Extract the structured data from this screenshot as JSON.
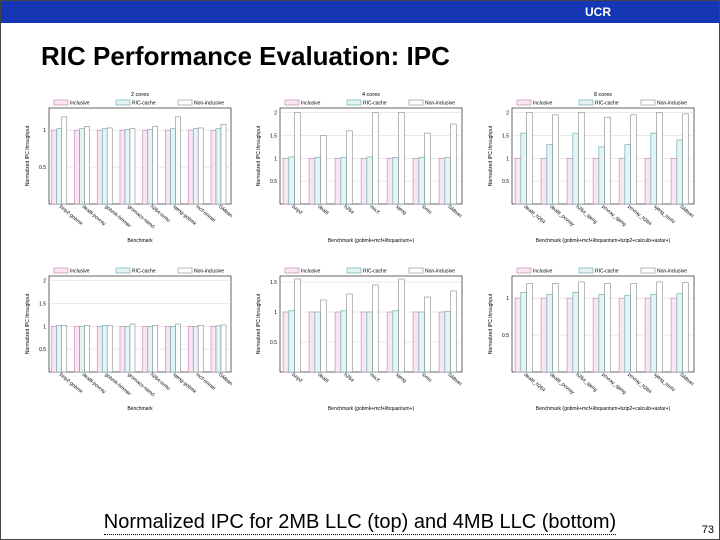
{
  "banner": "UCR",
  "title": "RIC Performance Evaluation: IPC",
  "caption": "Normalized IPC for 2MB LLC (top) and 4MB LLC (bottom)",
  "page_num": "73",
  "legend": [
    "Inclusive",
    "RIC-cache",
    "Non-inclusive"
  ],
  "ylabel": "Normalized IPC throughput",
  "xlabel": "Benchmark",
  "chart_data": [
    {
      "id": "p0",
      "title": "2 cores",
      "type": "bar",
      "ylim": [
        0,
        1.3
      ],
      "yticks": [
        0.5,
        1
      ],
      "xlabel_note": "Benchmark",
      "categories": [
        "bzip2-gobmk",
        "dealII-povray",
        "gobmk-hmmer",
        "gromacs-namd",
        "h264-tonto",
        "sjeng-gobmk",
        "mcf-omnet",
        "GMean"
      ],
      "series": [
        {
          "name": "Inclusive",
          "values": [
            1,
            1,
            1,
            1,
            1,
            1,
            1,
            1
          ]
        },
        {
          "name": "RIC-cache",
          "values": [
            1.02,
            1.02,
            1.02,
            1.01,
            1.01,
            1.02,
            1.02,
            1.02
          ]
        },
        {
          "name": "Non-inclusive",
          "values": [
            1.18,
            1.05,
            1.03,
            1.02,
            1.05,
            1.18,
            1.03,
            1.08
          ]
        }
      ]
    },
    {
      "id": "p1",
      "title": "4 cores",
      "type": "bar",
      "ylim": [
        0,
        2.1
      ],
      "yticks": [
        0.5,
        1,
        1.5,
        2
      ],
      "xlabel_note": "Benchmark (gobmk+mcf+libquantum+)",
      "categories": [
        "bzip2",
        "dealII",
        "h264",
        "mixX",
        "sjeng",
        "tonto",
        "GMean"
      ],
      "series": [
        {
          "name": "Inclusive",
          "values": [
            1,
            1,
            1,
            1,
            1,
            1,
            1
          ]
        },
        {
          "name": "RIC-cache",
          "values": [
            1.03,
            1.02,
            1.02,
            1.03,
            1.02,
            1.02,
            1.02
          ]
        },
        {
          "name": "Non-inclusive",
          "values": [
            2.0,
            1.5,
            1.6,
            2.0,
            2.0,
            1.55,
            1.75
          ]
        }
      ]
    },
    {
      "id": "p2",
      "title": "8 cores",
      "type": "bar",
      "ylim": [
        0,
        2.1
      ],
      "yticks": [
        0.5,
        1,
        1.5,
        2
      ],
      "xlabel_note": "Benchmark (gobmk+mcf+libquantum+bzip2+calculix+astar+)",
      "categories": [
        "dealII_h264",
        "dealII_povray",
        "h264_sjeng",
        "povray_sjeng",
        "povray_h264",
        "sjeng_tonto",
        "GMean"
      ],
      "series": [
        {
          "name": "Inclusive",
          "values": [
            1,
            1,
            1,
            1,
            1,
            1,
            1
          ]
        },
        {
          "name": "RIC-cache",
          "values": [
            1.55,
            1.3,
            1.55,
            1.25,
            1.3,
            1.55,
            1.4
          ]
        },
        {
          "name": "Non-inclusive",
          "values": [
            2.0,
            1.95,
            2.0,
            1.9,
            1.95,
            2.0,
            1.97
          ]
        }
      ]
    },
    {
      "id": "p3",
      "title": "",
      "type": "bar",
      "ylim": [
        0,
        2.1
      ],
      "yticks": [
        0.5,
        1,
        1.5,
        2
      ],
      "xlabel_note": "Benchmark",
      "categories": [
        "bzip2-gobmk",
        "dealII-povray",
        "gobmk-hmmer",
        "gromacs-namd",
        "h264-tonto",
        "sjeng-gobmk",
        "mcf-omnet",
        "GMean"
      ],
      "series": [
        {
          "name": "Inclusive",
          "values": [
            1,
            1,
            1,
            1,
            1,
            1,
            1,
            1
          ]
        },
        {
          "name": "RIC-cache",
          "values": [
            1.02,
            1.0,
            1.02,
            1.0,
            1.0,
            1.0,
            1.0,
            1.01
          ]
        },
        {
          "name": "Non-inclusive",
          "values": [
            1.02,
            1.02,
            1.02,
            1.05,
            1.02,
            1.05,
            1.02,
            1.03
          ]
        }
      ]
    },
    {
      "id": "p4",
      "title": "",
      "type": "bar",
      "ylim": [
        0,
        1.6
      ],
      "yticks": [
        0.5,
        1,
        1.5
      ],
      "xlabel_note": "Benchmark (gobmk+mcf+libquantum+)",
      "categories": [
        "bzip2",
        "dealII",
        "h264",
        "mixX",
        "sjeng",
        "tonto",
        "GMean"
      ],
      "series": [
        {
          "name": "Inclusive",
          "values": [
            1,
            1,
            1,
            1,
            1,
            1,
            1
          ]
        },
        {
          "name": "RIC-cache",
          "values": [
            1.02,
            1.0,
            1.02,
            1.0,
            1.02,
            1.0,
            1.01
          ]
        },
        {
          "name": "Non-inclusive",
          "values": [
            1.55,
            1.2,
            1.3,
            1.45,
            1.55,
            1.25,
            1.35
          ]
        }
      ]
    },
    {
      "id": "p5",
      "title": "",
      "type": "bar",
      "ylim": [
        0,
        1.3
      ],
      "yticks": [
        0.5,
        1
      ],
      "xlabel_note": "Benchmark (gobmk+mcf+libquantum+bzip2+calculix+astar+)",
      "categories": [
        "dealII_h264",
        "dealII_povray",
        "h264_sjeng",
        "povray_sjeng",
        "povray_h264",
        "sjeng_tonto",
        "GMean"
      ],
      "series": [
        {
          "name": "Inclusive",
          "values": [
            1,
            1,
            1,
            1,
            1,
            1,
            1
          ]
        },
        {
          "name": "RIC-cache",
          "values": [
            1.08,
            1.05,
            1.08,
            1.05,
            1.04,
            1.05,
            1.06
          ]
        },
        {
          "name": "Non-inclusive",
          "values": [
            1.2,
            1.2,
            1.22,
            1.2,
            1.2,
            1.22,
            1.21
          ]
        }
      ]
    }
  ]
}
